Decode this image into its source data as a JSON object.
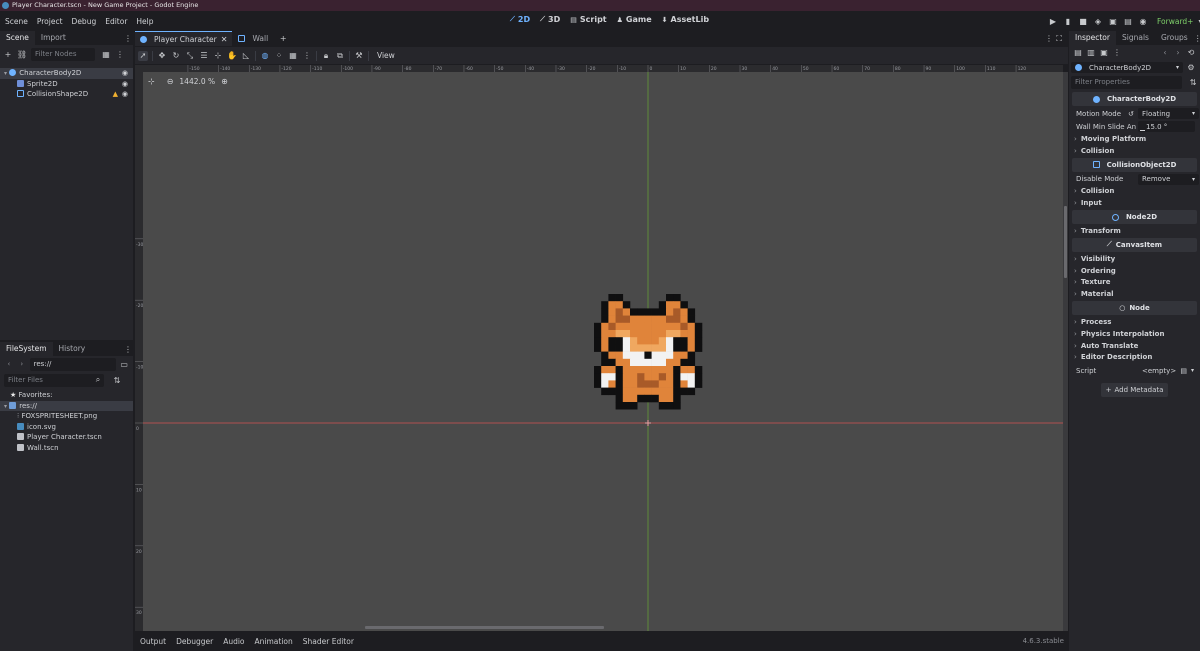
{
  "window": {
    "title": "Player Character.tscn - New Game Project - Godot Engine"
  },
  "menu": [
    "Scene",
    "Project",
    "Debug",
    "Editor",
    "Help"
  ],
  "workspaces": [
    {
      "label": "2D",
      "active": true
    },
    {
      "label": "3D",
      "active": false
    },
    {
      "label": "Script",
      "active": false
    },
    {
      "label": "Game",
      "active": false
    },
    {
      "label": "AssetLib",
      "active": false
    }
  ],
  "renderer": "Forward+",
  "scene_dock": {
    "tabs": [
      "Scene",
      "Import"
    ],
    "filter_placeholder": "Filter Nodes",
    "nodes": [
      {
        "label": "CharacterBody2D",
        "selected": true
      },
      {
        "label": "Sprite2D",
        "selected": false
      },
      {
        "label": "CollisionShape2D",
        "selected": false
      }
    ]
  },
  "filesystem_dock": {
    "tabs": [
      "FileSystem",
      "History"
    ],
    "path": "res://",
    "filter_placeholder": "Filter Files",
    "items": [
      {
        "label": "Favorites:"
      },
      {
        "label": "res://"
      },
      {
        "label": "FOXSPRITESHEET.png"
      },
      {
        "label": "icon.svg"
      },
      {
        "label": "Player Character.tscn"
      },
      {
        "label": "Wall.tscn"
      }
    ]
  },
  "scene_tabs": [
    {
      "label": "Player Character",
      "active": true
    },
    {
      "label": "Wall",
      "active": false
    }
  ],
  "toolbar": {
    "view_label": "View",
    "zoom": "1442.0 %"
  },
  "rulers": {
    "top": [
      "-150",
      "-140",
      "-130",
      "-120",
      "-110",
      "-100",
      "-90",
      "-80",
      "-70",
      "-60",
      "-50",
      "-40",
      "-30",
      "-20",
      "-10",
      "0",
      "10",
      "20",
      "30",
      "40",
      "50",
      "60",
      "70",
      "80",
      "90",
      "100",
      "110",
      "120"
    ],
    "left": [
      "-30",
      "-20",
      "-10",
      "0",
      "10",
      "20",
      "30",
      "40"
    ]
  },
  "inspector": {
    "tabs": [
      "Inspector",
      "Signals",
      "Groups"
    ],
    "object": "CharacterBody2D",
    "filter_placeholder": "Filter Properties",
    "sections": [
      {
        "title": "CharacterBody2D",
        "props": [
          {
            "label": "Motion Mode",
            "value": "Floating"
          },
          {
            "label": "Wall Min Slide An",
            "value": "15.0 °"
          }
        ],
        "groups": [
          "Moving Platform",
          "Collision"
        ]
      },
      {
        "title": "CollisionObject2D",
        "props": [
          {
            "label": "Disable Mode",
            "value": "Remove"
          }
        ],
        "groups": [
          "Collision",
          "Input"
        ]
      },
      {
        "title": "Node2D",
        "props": [],
        "groups": [
          "Transform"
        ]
      },
      {
        "title": "CanvasItem",
        "props": [],
        "groups": [
          "Visibility",
          "Ordering",
          "Texture",
          "Material"
        ]
      },
      {
        "title": "Node",
        "props": [],
        "groups": [
          "Process",
          "Physics Interpolation",
          "Auto Translate",
          "Editor Description"
        ]
      }
    ],
    "script_label": "Script",
    "script_value": "<empty>",
    "add_metadata": "Add Metadata"
  },
  "bottom_tabs": [
    "Output",
    "Debugger",
    "Audio",
    "Animation",
    "Shader Editor"
  ],
  "version": "4.6.3.stable",
  "colors": {
    "accent": "#6fb3ff",
    "background": "#1d1d21",
    "panel": "#26262b",
    "viewport": "#4a4a4a",
    "x_axis": "#b05050",
    "y_axis": "#5e8a3a"
  }
}
